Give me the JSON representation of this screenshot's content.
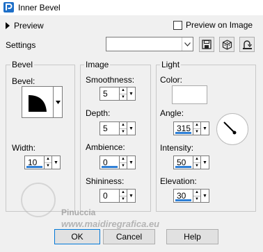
{
  "window": {
    "title": "Inner Bevel"
  },
  "preview": {
    "label": "Preview",
    "on_image_label": "Preview on Image",
    "on_image_checked": false
  },
  "settings": {
    "label": "Settings",
    "value": ""
  },
  "bevel_group": {
    "title": "Bevel",
    "bevel_label": "Bevel:",
    "width_label": "Width:",
    "width_value": "10"
  },
  "image_group": {
    "title": "Image",
    "smoothness_label": "Smoothness:",
    "smoothness_value": "5",
    "depth_label": "Depth:",
    "depth_value": "5",
    "ambience_label": "Ambience:",
    "ambience_value": "0",
    "shininess_label": "Shininess:",
    "shininess_value": "0"
  },
  "light_group": {
    "title": "Light",
    "color_label": "Color:",
    "color_value": "#ffffff",
    "angle_label": "Angle:",
    "angle_value": "315",
    "intensity_label": "Intensity:",
    "intensity_value": "50",
    "elevation_label": "Elevation:",
    "elevation_value": "30"
  },
  "buttons": {
    "ok": "OK",
    "cancel": "Cancel",
    "help": "Help"
  },
  "watermark": {
    "name": "Pinuccia",
    "site": "www.maidiregrafica.eu"
  },
  "colors": {
    "accent": "#2d7fd6",
    "background": "#f0f0f0",
    "app_icon": "#1e6fc8"
  }
}
